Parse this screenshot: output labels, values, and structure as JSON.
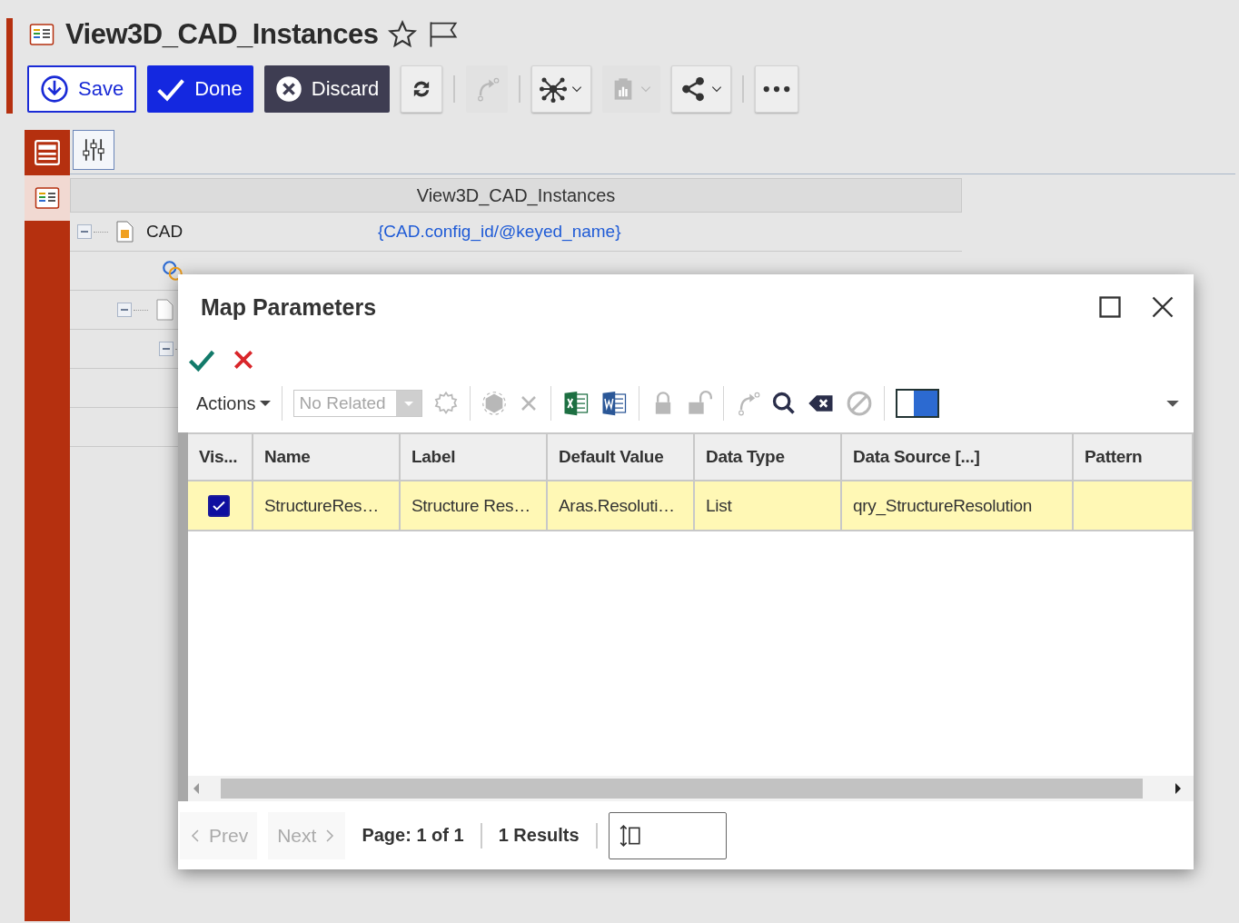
{
  "header": {
    "title": "View3D_CAD_Instances",
    "favorite": false
  },
  "toolbar": {
    "buttons": [
      {
        "kind": "save",
        "label": "Save"
      },
      {
        "kind": "done",
        "label": "Done"
      },
      {
        "kind": "discard",
        "label": "Discard"
      }
    ],
    "tools": [
      {
        "kind": "refresh",
        "disabled": false,
        "dropdown": false
      },
      {
        "kind": "sep"
      },
      {
        "kind": "promote",
        "disabled": true,
        "dropdown": false
      },
      {
        "kind": "sep"
      },
      {
        "kind": "network",
        "disabled": false,
        "dropdown": true
      },
      {
        "kind": "report",
        "disabled": true,
        "dropdown": true
      },
      {
        "kind": "share",
        "disabled": false,
        "dropdown": true
      },
      {
        "kind": "sep"
      },
      {
        "kind": "more",
        "disabled": false,
        "dropdown": false
      }
    ]
  },
  "side_tabs": [
    {
      "kind": "form",
      "selected": false
    },
    {
      "kind": "tree",
      "selected": true
    }
  ],
  "view_tabs": [
    {
      "kind": "parameters",
      "selected": true
    }
  ],
  "tree": {
    "title": "View3D_CAD_Instances",
    "rows": [
      {
        "kind": "item",
        "label": "CAD",
        "value": "{CAD.config_id/@keyed_name}",
        "expanded": true
      },
      {
        "kind": "relationship"
      },
      {
        "kind": "item",
        "expanded": true
      },
      {
        "kind": "group",
        "expanded": true
      }
    ]
  },
  "dialog": {
    "title": "Map Parameters",
    "toolbar": {
      "actions": "Actions",
      "related_placeholder": "No Related",
      "tools": [
        {
          "kind": "pick",
          "disabled": true
        },
        {
          "kind": "sep"
        },
        {
          "kind": "pick-all",
          "disabled": true
        },
        {
          "kind": "delete",
          "disabled": true
        },
        {
          "kind": "sep"
        },
        {
          "kind": "excel",
          "disabled": false
        },
        {
          "kind": "word",
          "disabled": false
        },
        {
          "kind": "sep"
        },
        {
          "kind": "lock",
          "disabled": true
        },
        {
          "kind": "unlock",
          "disabled": true
        },
        {
          "kind": "sep"
        },
        {
          "kind": "promote",
          "disabled": true
        },
        {
          "kind": "search",
          "disabled": false
        },
        {
          "kind": "clear",
          "disabled": false
        },
        {
          "kind": "cancel",
          "disabled": true
        },
        {
          "kind": "sep"
        },
        {
          "kind": "color",
          "disabled": false
        }
      ]
    },
    "columns": [
      "Vis...",
      "Name",
      "Label",
      "Default Value",
      "Data Type",
      "Data Source [...]",
      "Pattern"
    ],
    "rows": [
      {
        "selected": true,
        "visible": true,
        "cells": [
          "",
          "StructureRes…",
          "Structure Res…",
          "Aras.Resoluti…",
          "List",
          "qry_StructureResolution",
          ""
        ]
      }
    ],
    "pager": {
      "prev": {
        "label": "Prev",
        "disabled": true
      },
      "next": {
        "label": "Next",
        "disabled": true
      },
      "page": "Page: 1 of 1",
      "results": "1 Results"
    }
  }
}
